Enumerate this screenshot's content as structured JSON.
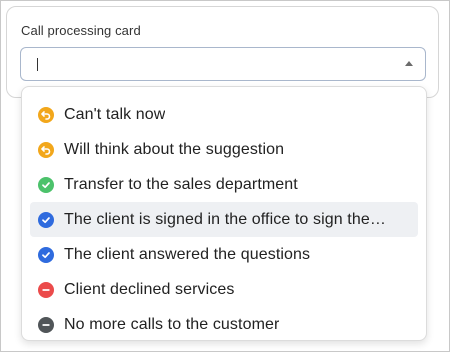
{
  "field": {
    "label": "Call processing card",
    "value": ""
  },
  "options": [
    {
      "label": "Can't talk now",
      "icon": "orange-undo-icon",
      "color": "#F2A71B"
    },
    {
      "label": "Will think about the suggestion",
      "icon": "orange-undo-icon",
      "color": "#F2A71B"
    },
    {
      "label": "Transfer to the sales department",
      "icon": "green-check-icon",
      "color": "#4CC26B"
    },
    {
      "label": "The client is signed in the office to sign the…",
      "icon": "blue-check-icon",
      "color": "#2F6BDE",
      "highlighted": true
    },
    {
      "label": "The client answered the questions",
      "icon": "blue-check-icon",
      "color": "#2F6BDE"
    },
    {
      "label": "Client declined services",
      "icon": "red-minus-icon",
      "color": "#EB4B4B"
    },
    {
      "label": "No more calls to the customer",
      "icon": "dark-minus-icon",
      "color": "#505558"
    }
  ]
}
